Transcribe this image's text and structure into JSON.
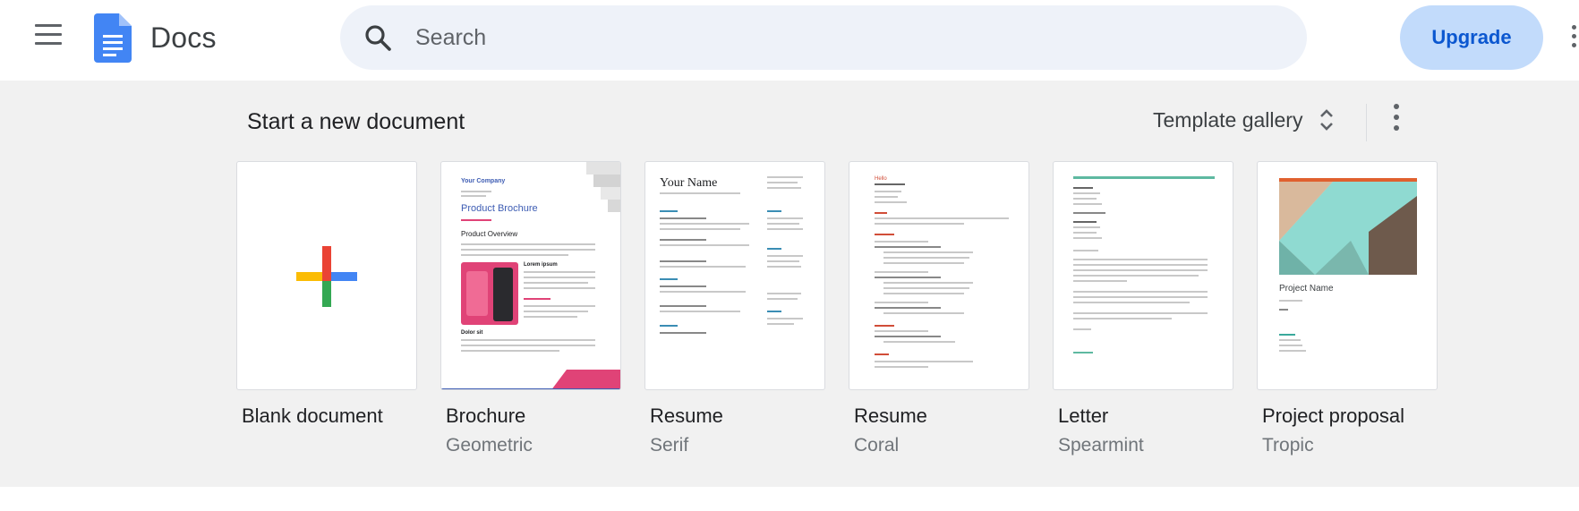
{
  "header": {
    "app_title": "Docs",
    "menu_icon": "menu-icon",
    "logo_icon": "docs-logo-icon",
    "search": {
      "placeholder": "Search",
      "icon": "search-icon"
    },
    "upgrade_label": "Upgrade",
    "more_icon": "more-vert-icon"
  },
  "templates": {
    "section_title": "Start a new document",
    "gallery_label": "Template gallery",
    "gallery_icon": "unfold-icon",
    "more_icon": "more-vert-icon",
    "items": [
      {
        "title": "Blank document",
        "subtitle": ""
      },
      {
        "title": "Brochure",
        "subtitle": "Geometric",
        "preview": {
          "company": "Your Company",
          "heading": "Product Brochure",
          "section": "Product Overview",
          "sub1": "Lorem ipsum",
          "sub2": "Dolor sit"
        }
      },
      {
        "title": "Resume",
        "subtitle": "Serif",
        "preview": {
          "name": "Your Name"
        }
      },
      {
        "title": "Resume",
        "subtitle": "Coral",
        "preview": {
          "name": "Hello"
        }
      },
      {
        "title": "Letter",
        "subtitle": "Spearmint",
        "preview": {}
      },
      {
        "title": "Project proposal",
        "subtitle": "Tropic",
        "preview": {
          "heading": "Project Name"
        }
      }
    ]
  },
  "colors": {
    "accent_blue": "#0b57d0",
    "upgrade_bg": "#c2dbfb",
    "search_bg": "#eef2f9",
    "section_bg": "#f1f1f1",
    "plus_red": "#ea4335",
    "plus_blue": "#4285f4",
    "plus_green": "#34a853",
    "plus_yellow": "#fbbc04"
  }
}
